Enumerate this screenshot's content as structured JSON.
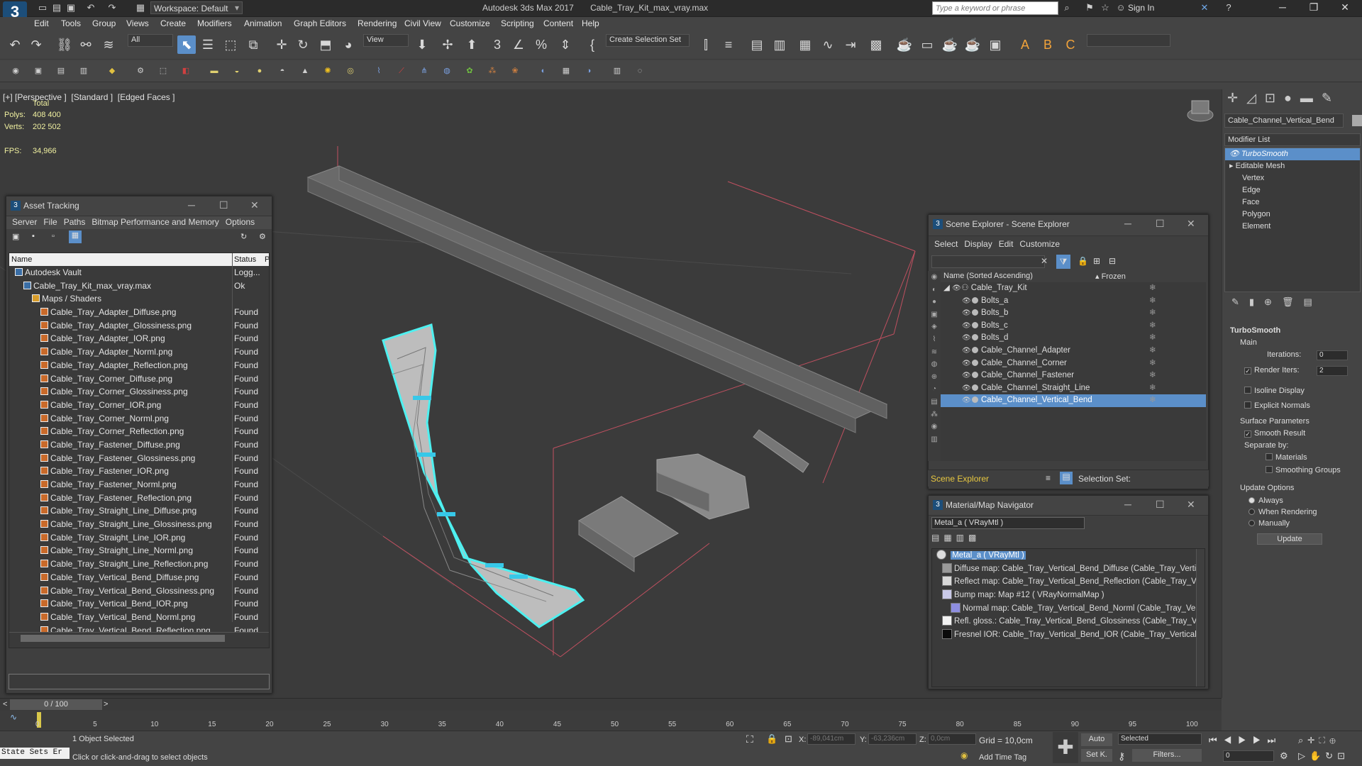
{
  "titlebar": {
    "workspace": "Workspace: Default",
    "app_title": "Autodesk 3ds Max 2017       Cable_Tray_Kit_max_vray.max",
    "search_placeholder": "Type a keyword or phrase",
    "sign_in": "Sign In"
  },
  "menubar": [
    "Edit",
    "Tools",
    "Group",
    "Views",
    "Create",
    "Modifiers",
    "Animation",
    "Graph Editors",
    "Rendering",
    "Civil View",
    "Customize",
    "Scripting",
    "Content",
    "Help"
  ],
  "toolbar": {
    "filter": "All",
    "view": "View",
    "selection_set": "Create Selection Set"
  },
  "viewport": {
    "label": "[+] [Perspective ]  [Standard ]  [Edged Faces ]",
    "total": "Total",
    "polys_label": "Polys:",
    "polys": "408 400",
    "verts_label": "Verts:",
    "verts": "202 502",
    "fps_label": "FPS:",
    "fps": "34,966"
  },
  "asset_tracking": {
    "title": "Asset Tracking",
    "menu": [
      "Server",
      "File",
      "Paths",
      "Bitmap Performance and Memory",
      "Options"
    ],
    "col_name": "Name",
    "col_status": "Status",
    "col_p": "P",
    "rows": [
      {
        "name": "Autodesk Vault",
        "status": "Logg...",
        "indent": 0,
        "kind": "m"
      },
      {
        "name": "Cable_Tray_Kit_max_vray.max",
        "status": "Ok",
        "indent": 1,
        "kind": "m"
      },
      {
        "name": "Maps / Shaders",
        "status": "",
        "indent": 2,
        "kind": "f"
      },
      {
        "name": "Cable_Tray_Adapter_Diffuse.png",
        "status": "Found",
        "indent": 3,
        "kind": "i"
      },
      {
        "name": "Cable_Tray_Adapter_Glossiness.png",
        "status": "Found",
        "indent": 3,
        "kind": "i"
      },
      {
        "name": "Cable_Tray_Adapter_IOR.png",
        "status": "Found",
        "indent": 3,
        "kind": "i"
      },
      {
        "name": "Cable_Tray_Adapter_Norml.png",
        "status": "Found",
        "indent": 3,
        "kind": "i"
      },
      {
        "name": "Cable_Tray_Adapter_Reflection.png",
        "status": "Found",
        "indent": 3,
        "kind": "i"
      },
      {
        "name": "Cable_Tray_Corner_Diffuse.png",
        "status": "Found",
        "indent": 3,
        "kind": "i"
      },
      {
        "name": "Cable_Tray_Corner_Glossiness.png",
        "status": "Found",
        "indent": 3,
        "kind": "i"
      },
      {
        "name": "Cable_Tray_Corner_IOR.png",
        "status": "Found",
        "indent": 3,
        "kind": "i"
      },
      {
        "name": "Cable_Tray_Corner_Norml.png",
        "status": "Found",
        "indent": 3,
        "kind": "i"
      },
      {
        "name": "Cable_Tray_Corner_Reflection.png",
        "status": "Found",
        "indent": 3,
        "kind": "i"
      },
      {
        "name": "Cable_Tray_Fastener_Diffuse.png",
        "status": "Found",
        "indent": 3,
        "kind": "i"
      },
      {
        "name": "Cable_Tray_Fastener_Glossiness.png",
        "status": "Found",
        "indent": 3,
        "kind": "i"
      },
      {
        "name": "Cable_Tray_Fastener_IOR.png",
        "status": "Found",
        "indent": 3,
        "kind": "i"
      },
      {
        "name": "Cable_Tray_Fastener_Norml.png",
        "status": "Found",
        "indent": 3,
        "kind": "i"
      },
      {
        "name": "Cable_Tray_Fastener_Reflection.png",
        "status": "Found",
        "indent": 3,
        "kind": "i"
      },
      {
        "name": "Cable_Tray_Straight_Line_Diffuse.png",
        "status": "Found",
        "indent": 3,
        "kind": "i"
      },
      {
        "name": "Cable_Tray_Straight_Line_Glossiness.png",
        "status": "Found",
        "indent": 3,
        "kind": "i"
      },
      {
        "name": "Cable_Tray_Straight_Line_IOR.png",
        "status": "Found",
        "indent": 3,
        "kind": "i"
      },
      {
        "name": "Cable_Tray_Straight_Line_Norml.png",
        "status": "Found",
        "indent": 3,
        "kind": "i"
      },
      {
        "name": "Cable_Tray_Straight_Line_Reflection.png",
        "status": "Found",
        "indent": 3,
        "kind": "i"
      },
      {
        "name": "Cable_Tray_Vertical_Bend_Diffuse.png",
        "status": "Found",
        "indent": 3,
        "kind": "i"
      },
      {
        "name": "Cable_Tray_Vertical_Bend_Glossiness.png",
        "status": "Found",
        "indent": 3,
        "kind": "i"
      },
      {
        "name": "Cable_Tray_Vertical_Bend_IOR.png",
        "status": "Found",
        "indent": 3,
        "kind": "i"
      },
      {
        "name": "Cable_Tray_Vertical_Bend_Norml.png",
        "status": "Found",
        "indent": 3,
        "kind": "i"
      },
      {
        "name": "Cable_Tray_Vertical_Bend_Reflection.png",
        "status": "Found",
        "indent": 3,
        "kind": "i"
      }
    ]
  },
  "scene_explorer": {
    "title": "Scene Explorer - Scene Explorer",
    "menu": [
      "Select",
      "Display",
      "Edit",
      "Customize"
    ],
    "col_name": "Name (Sorted Ascending)",
    "col_frozen": "▴ Frozen",
    "root": "Cable_Tray_Kit",
    "items": [
      "Bolts_a",
      "Bolts_b",
      "Bolts_c",
      "Bolts_d",
      "Cable_Channel_Adapter",
      "Cable_Channel_Corner",
      "Cable_Channel_Fastener",
      "Cable_Channel_Straight_Line",
      "Cable_Channel_Vertical_Bend"
    ],
    "selected_index": 8,
    "footer_left": "Scene Explorer",
    "footer_right": "Selection Set:"
  },
  "material_nav": {
    "title": "Material/Map Navigator",
    "current": "Metal_a  ( VRayMtl )",
    "root": "Metal_a  ( VRayMtl )",
    "entries": [
      {
        "text": "Diffuse map: Cable_Tray_Vertical_Bend_Diffuse (Cable_Tray_Vertical_B",
        "color": "#9a9a9a"
      },
      {
        "text": "Reflect map: Cable_Tray_Vertical_Bend_Reflection (Cable_Tray_Vertica",
        "color": "#d9d9d9"
      },
      {
        "text": "Bump map: Map #12  ( VRayNormalMap )",
        "color": "#c9c9e8"
      },
      {
        "text": "Normal map: Cable_Tray_Vertical_Bend_Norml (Cable_Tray_Vertical_",
        "color": "#8e8ee0"
      },
      {
        "text": "Refl. gloss.: Cable_Tray_Vertical_Bend_Glossiness (Cable_Tray_Vertical_",
        "color": "#f2f2f2"
      },
      {
        "text": "Fresnel IOR: Cable_Tray_Vertical_Bend_IOR (Cable_Tray_Vertical_Benc",
        "color": "#0a0a0a"
      }
    ]
  },
  "command_panel": {
    "object_name": "Cable_Channel_Vertical_Bend",
    "modifier_list": "Modifier List",
    "stack": [
      {
        "label": "TurboSmooth",
        "selected": true,
        "indent": 0
      },
      {
        "label": "Editable Mesh",
        "selected": false,
        "indent": 0
      },
      {
        "label": "Vertex",
        "selected": false,
        "indent": 1
      },
      {
        "label": "Edge",
        "selected": false,
        "indent": 1
      },
      {
        "label": "Face",
        "selected": false,
        "indent": 1
      },
      {
        "label": "Polygon",
        "selected": false,
        "indent": 1
      },
      {
        "label": "Element",
        "selected": false,
        "indent": 1
      }
    ],
    "rollout": "TurboSmooth",
    "main": "Main",
    "iterations_label": "Iterations:",
    "iterations": "0",
    "render_iters_label": "Render Iters:",
    "render_iters": "2",
    "isoline": "Isoline Display",
    "explicit": "Explicit Normals",
    "surface": "Surface Parameters",
    "smooth_result": "Smooth Result",
    "separate_by": "Separate by:",
    "materials": "Materials",
    "smoothing_groups": "Smoothing Groups",
    "update_options": "Update Options",
    "always": "Always",
    "when_rendering": "When Rendering",
    "manually": "Manually",
    "update": "Update"
  },
  "timeline": {
    "frame": "0 / 100",
    "ticks": [
      "0",
      "5",
      "10",
      "15",
      "20",
      "25",
      "30",
      "35",
      "40",
      "45",
      "50",
      "55",
      "60",
      "65",
      "70",
      "75",
      "80",
      "85",
      "90",
      "95",
      "100"
    ]
  },
  "status": {
    "state_sets": "State Sets Er",
    "selected": "1 Object Selected",
    "prompt": "Click or click-and-drag to select objects",
    "x_label": "X:",
    "x": "-89,041cm",
    "y_label": "Y:",
    "y": "-63,236cm",
    "z_label": "Z:",
    "z": "0,0cm",
    "grid": "Grid = 10,0cm",
    "add_time_tag": "Add Time Tag",
    "auto": "Auto",
    "set_k": "Set K.",
    "selected_dd": "Selected",
    "filters": "Filters...",
    "frame_field": "0"
  }
}
